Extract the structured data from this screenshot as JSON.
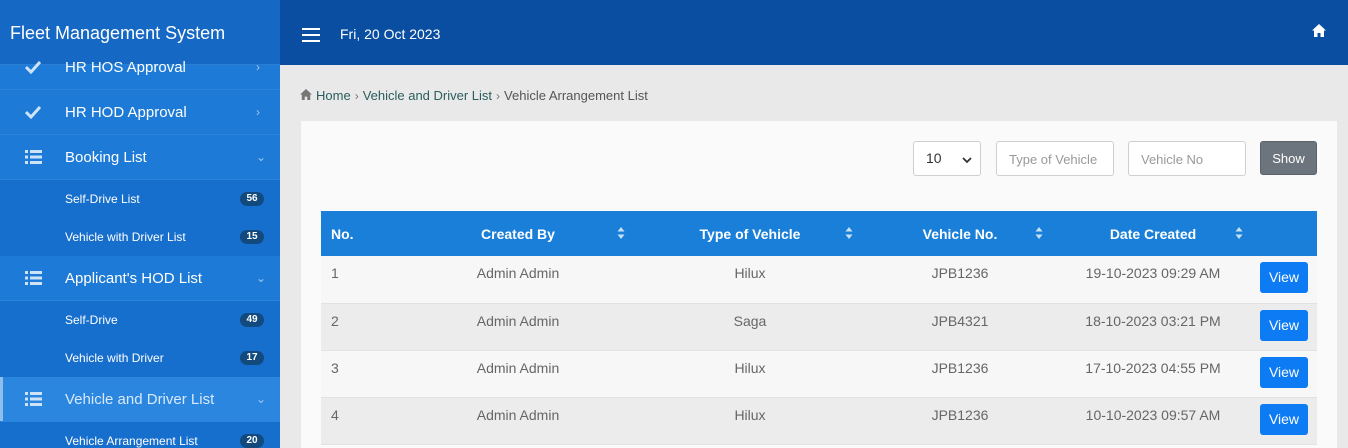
{
  "app": {
    "title": "Fleet Management System"
  },
  "topbar": {
    "date": "Fri, 20 Oct 2023"
  },
  "sidebar": {
    "items": [
      {
        "label": "HR HOS Approval"
      },
      {
        "label": "HR HOD Approval"
      },
      {
        "label": "Booking List"
      },
      {
        "label": "Self-Drive List",
        "count": "56"
      },
      {
        "label": "Vehicle with Driver List",
        "count": "15"
      },
      {
        "label": "Applicant's HOD List"
      },
      {
        "label": "Self-Drive",
        "count": "49"
      },
      {
        "label": "Vehicle with Driver",
        "count": "17"
      },
      {
        "label": "Vehicle and Driver List"
      },
      {
        "label": "Vehicle Arrangement List",
        "count": "20"
      }
    ]
  },
  "breadcrumb": {
    "home": "Home",
    "parent": "Vehicle and Driver List",
    "current": "Vehicle Arrangement List"
  },
  "filters": {
    "page_length": "10",
    "type_placeholder": "Type of Vehicle",
    "vehicle_no_placeholder": "Vehicle No",
    "show_label": "Show"
  },
  "table": {
    "headers": [
      "No.",
      "Created By",
      "Type of Vehicle",
      "Vehicle No.",
      "Date Created"
    ],
    "view_label": "View",
    "rows": [
      {
        "no": "1",
        "created_by": "Admin Admin",
        "type": "Hilux",
        "vehicle_no": "JPB1236",
        "date": "19-10-2023 09:29 AM"
      },
      {
        "no": "2",
        "created_by": "Admin Admin",
        "type": "Saga",
        "vehicle_no": "JPB4321",
        "date": "18-10-2023 03:21 PM"
      },
      {
        "no": "3",
        "created_by": "Admin Admin",
        "type": "Hilux",
        "vehicle_no": "JPB1236",
        "date": "17-10-2023 04:55 PM"
      },
      {
        "no": "4",
        "created_by": "Admin Admin",
        "type": "Hilux",
        "vehicle_no": "JPB1236",
        "date": "10-10-2023 09:57 AM"
      }
    ]
  },
  "icons": {
    "check": "check-icon",
    "list": "list-icon",
    "chevron_right": "chevron-right-icon",
    "chevron_down": "chevron-down-icon",
    "home": "home-icon",
    "menu": "hamburger-icon",
    "sort": "sort-icon"
  }
}
